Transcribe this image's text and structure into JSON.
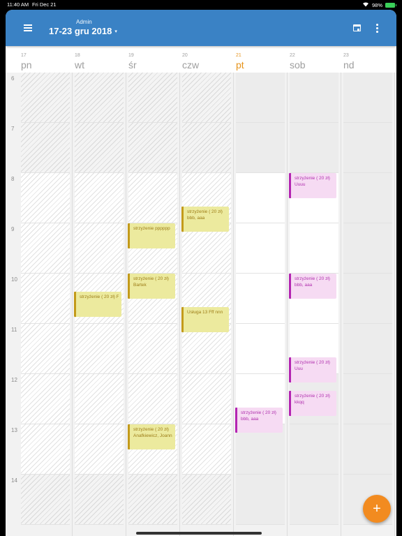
{
  "status_bar": {
    "time": "11:40 AM",
    "date": "Fri Dec 21",
    "battery": "98%"
  },
  "header": {
    "user": "Admin",
    "date_range": "17-23 gru 2018",
    "range_caret": "▾",
    "menu_icon": "hamburger-menu-icon",
    "calendar_icon": "calendar-today-icon",
    "more_icon": "more-vertical-icon",
    "color": "#3a82c5"
  },
  "days": [
    {
      "num": "17",
      "name": "pn"
    },
    {
      "num": "18",
      "name": "wt"
    },
    {
      "num": "19",
      "name": "śr"
    },
    {
      "num": "20",
      "name": "czw"
    },
    {
      "num": "21",
      "name": "pt",
      "today": true
    },
    {
      "num": "22",
      "name": "sob"
    },
    {
      "num": "23",
      "name": "nd"
    }
  ],
  "hours": [
    "6",
    "7",
    "8",
    "9",
    "10",
    "11",
    "12",
    "13",
    "14"
  ],
  "events": [
    {
      "day": 1,
      "start": "10:22",
      "end": "10:52",
      "title": "strzyżenie ( 20 zł)  Fff",
      "subtitle": "",
      "color": "yellow"
    },
    {
      "day": 2,
      "start": "9:00",
      "end": "9:30",
      "title": "strzyżenie pppppp",
      "subtitle": "",
      "color": "yellow"
    },
    {
      "day": 2,
      "start": "10:00",
      "end": "10:30",
      "title": "strzyżenie ( 20 zł)",
      "subtitle": "Bartek",
      "color": "yellow"
    },
    {
      "day": 2,
      "start": "13:00",
      "end": "13:30",
      "title": "strzyżenie ( 20 zł)",
      "subtitle": "Anafkiewicz, Joanna",
      "color": "yellow"
    },
    {
      "day": 3,
      "start": "8:40",
      "end": "9:10",
      "title": "strzyżenie ( 20 zł)",
      "subtitle": "bbb, aaa",
      "color": "yellow"
    },
    {
      "day": 3,
      "start": "10:40",
      "end": "11:10",
      "title": "Usługa 13  Fff nnn",
      "subtitle": "",
      "color": "yellow"
    },
    {
      "day": 4,
      "start": "12:40",
      "end": "13:10",
      "title": "strzyżenie ( 20 zł)",
      "subtitle": "bbb, aaa",
      "color": "pink"
    },
    {
      "day": 5,
      "start": "8:00",
      "end": "8:30",
      "title": "strzyżenie ( 20 zł)",
      "subtitle": "Uuuu",
      "color": "pink"
    },
    {
      "day": 5,
      "start": "10:00",
      "end": "10:30",
      "title": "strzyżenie ( 20 zł)",
      "subtitle": "bbb, aaa",
      "color": "pink"
    },
    {
      "day": 5,
      "start": "11:40",
      "end": "12:10",
      "title": "strzyżenie ( 20 zł)",
      "subtitle": "Uuu",
      "color": "pink"
    },
    {
      "day": 5,
      "start": "12:20",
      "end": "12:50",
      "title": "strzyżenie ( 20 zł)",
      "subtitle": "kkqq",
      "color": "pink"
    }
  ],
  "fab": {
    "label": "+",
    "icon": "add-icon",
    "color": "#f28b20"
  }
}
